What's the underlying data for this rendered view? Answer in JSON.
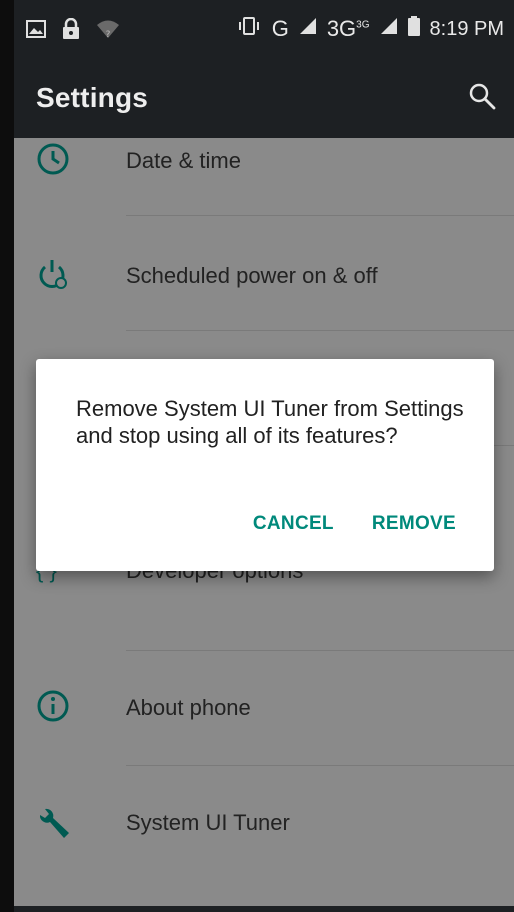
{
  "status_bar": {
    "left_icons": [
      "image-icon",
      "lock-icon",
      "wifi-icon"
    ],
    "network_type": "G",
    "network_type_secondary": "3G",
    "network_sup": "3G",
    "time": "8:19 PM"
  },
  "toolbar": {
    "title": "Settings",
    "search_icon": "search-icon"
  },
  "settings_list": [
    {
      "label": "Date & time",
      "icon": "clock-icon"
    },
    {
      "label": "Scheduled power on & off",
      "icon": "power-schedule-icon"
    },
    {
      "label": "",
      "icon": ""
    },
    {
      "label": "",
      "icon": ""
    },
    {
      "label": "Developer options",
      "icon": "braces-icon"
    },
    {
      "label": "About phone",
      "icon": "info-icon"
    },
    {
      "label": "System UI Tuner",
      "icon": "wrench-icon"
    }
  ],
  "dialog": {
    "message": "Remove System UI Tuner from Settings and stop using all of its features?",
    "cancel_label": "CANCEL",
    "remove_label": "REMOVE"
  },
  "colors": {
    "accent": "#00897b",
    "toolbar_bg": "#1d2023",
    "scrim_list_bg": "#8a8a8a"
  }
}
